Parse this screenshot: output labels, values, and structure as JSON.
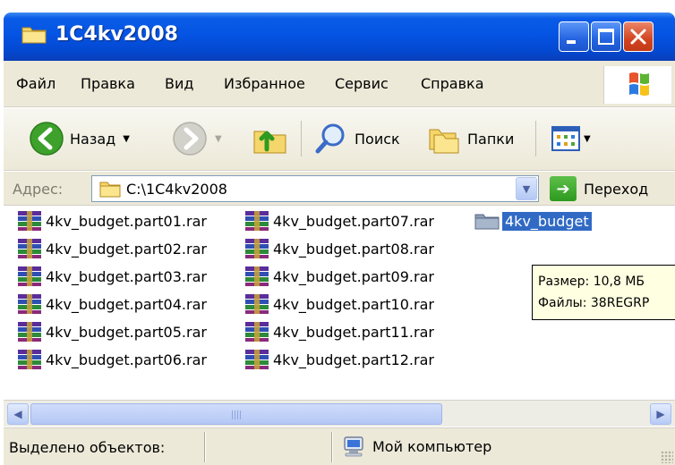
{
  "window": {
    "title": "1C4kv2008",
    "controls": {
      "minimize": "minimize",
      "maximize": "maximize",
      "close": "close"
    }
  },
  "menubar": {
    "items": [
      "Файл",
      "Правка",
      "Вид",
      "Избранное",
      "Сервис",
      "Справка"
    ]
  },
  "toolbar": {
    "back_label": "Назад",
    "search_label": "Поиск",
    "folders_label": "Папки"
  },
  "address": {
    "label": "Адрес:",
    "value": "C:\\1C4kv2008",
    "go_label": "Переход"
  },
  "files": {
    "column1": [
      "4kv_budget.part01.rar",
      "4kv_budget.part02.rar",
      "4kv_budget.part03.rar",
      "4kv_budget.part04.rar",
      "4kv_budget.part05.rar",
      "4kv_budget.part06.rar"
    ],
    "column2": [
      "4kv_budget.part07.rar",
      "4kv_budget.part08.rar",
      "4kv_budget.part09.rar",
      "4kv_budget.part10.rar",
      "4kv_budget.part11.rar",
      "4kv_budget.part12.rar"
    ],
    "folder": "4kv_budget"
  },
  "tooltip": {
    "line1": "Размер: 10,8 МБ",
    "line2": "Файлы: 38REGRP"
  },
  "statusbar": {
    "left": "Выделено объектов:",
    "right": "Мой компьютер"
  },
  "colors": {
    "titlebar": "#0554e3",
    "chrome": "#ece9d8",
    "selection": "#316ac5",
    "tooltip_bg": "#ffffe1"
  }
}
